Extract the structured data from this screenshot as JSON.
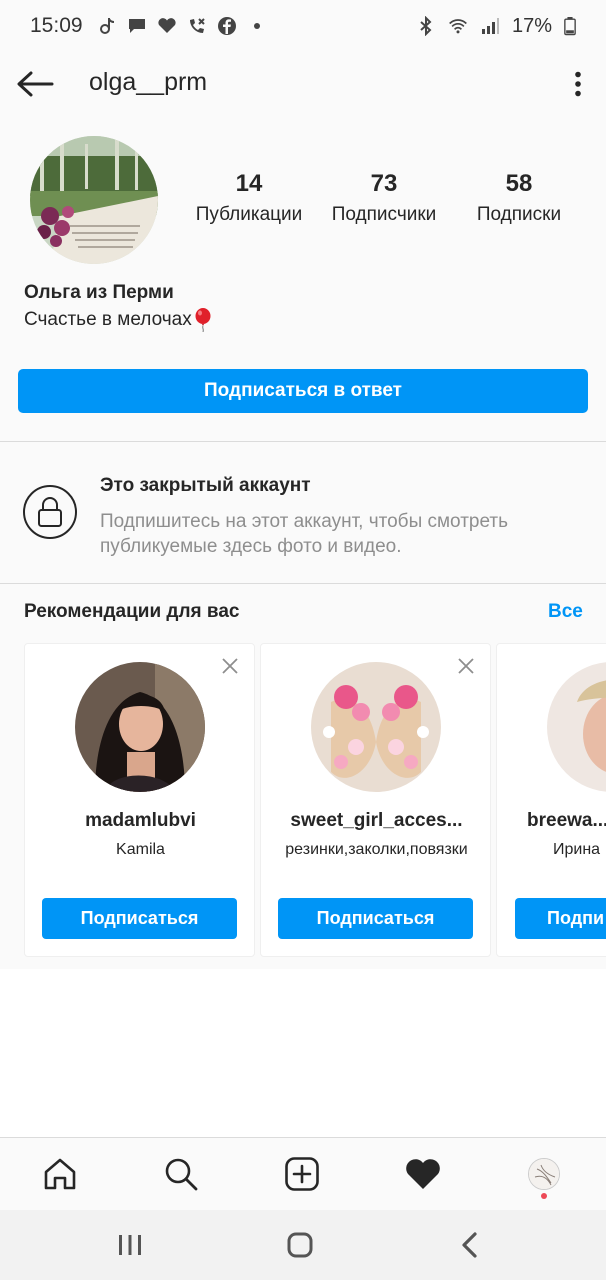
{
  "status_bar": {
    "time": "15:09",
    "battery": "17%",
    "left_icons": [
      "tiktok-icon",
      "message-icon",
      "heart-icon",
      "missed-call-icon",
      "facebook-icon",
      "dot-icon"
    ],
    "right_icons": [
      "bluetooth-icon",
      "wifi-icon",
      "signal-icon",
      "battery-icon"
    ]
  },
  "header": {
    "username": "olga__prm"
  },
  "profile": {
    "stats": [
      {
        "value": "14",
        "label": "Публикации"
      },
      {
        "value": "73",
        "label": "Подписчики"
      },
      {
        "value": "58",
        "label": "Подписки"
      }
    ],
    "full_name": "Ольга из Перми",
    "bio": "Счастье в мелочах",
    "follow_back_label": "Подписаться в ответ"
  },
  "private_notice": {
    "title": "Это закрытый аккаунт",
    "description": "Подпишитесь на этот аккаунт, чтобы смотреть публикуемые здесь фото и видео."
  },
  "suggestions": {
    "title": "Рекомендации для вас",
    "see_all_label": "Все",
    "cards": [
      {
        "username": "madamlubvi",
        "subtitle": "Kamila",
        "button_label": "Подписаться"
      },
      {
        "username": "sweet_girl_acces...",
        "subtitle": "резинки,заколки,повязки",
        "button_label": "Подписаться"
      },
      {
        "username": "breewa...",
        "subtitle": "Ирина",
        "button_label": "Подпи"
      }
    ]
  },
  "colors": {
    "accent": "#0095f6",
    "text": "#262626",
    "secondary_text": "#8e8e8e",
    "notification_dot": "#ed4956"
  }
}
